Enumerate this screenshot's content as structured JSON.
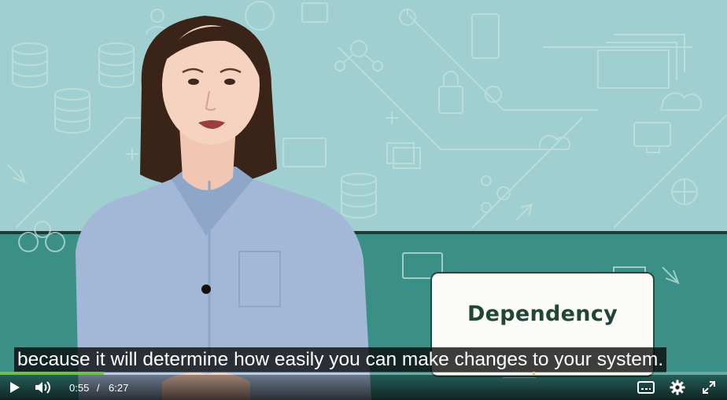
{
  "video": {
    "card_label": "Dependency",
    "caption": "because it will determine how easily you can make changes to your system.",
    "progress": 0.143,
    "chapter_marker_fraction": 0.733
  },
  "controls": {
    "current_time": "0:55",
    "separator": "/",
    "duration": "6:27",
    "icons": [
      "play-icon",
      "volume-icon",
      "captions-icon",
      "settings-icon",
      "fullscreen-icon"
    ]
  },
  "colors": {
    "background_top": "#9fcfd0",
    "background_bottom": "#3a8f87",
    "progress_accent": "#6dc04a",
    "card_text": "#22443a"
  }
}
